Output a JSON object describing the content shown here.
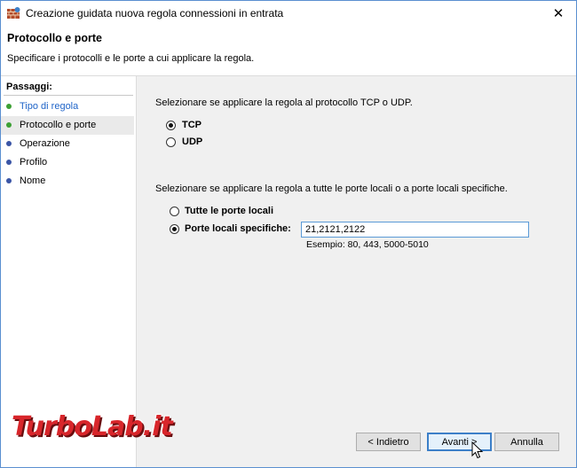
{
  "window": {
    "title": "Creazione guidata nuova regola connessioni in entrata",
    "close_label": "✕"
  },
  "header": {
    "title": "Protocollo e porte",
    "subtitle": "Specificare i protocolli e le porte a cui applicare la regola."
  },
  "sidebar": {
    "label": "Passaggi:",
    "steps": [
      {
        "label": "Tipo di regola",
        "state": "completed"
      },
      {
        "label": "Protocollo e porte",
        "state": "current"
      },
      {
        "label": "Operazione",
        "state": "pending"
      },
      {
        "label": "Profilo",
        "state": "pending"
      },
      {
        "label": "Nome",
        "state": "pending"
      }
    ]
  },
  "protocol": {
    "question": "Selezionare se applicare la regola al protocollo TCP o UDP.",
    "tcp_label": "TCP",
    "udp_label": "UDP",
    "selected": "TCP"
  },
  "ports": {
    "question": "Selezionare se applicare la regola a tutte le porte locali o a porte locali specifiche.",
    "all_label": "Tutte le porte locali",
    "specific_label": "Porte locali specifiche:",
    "selected": "specific",
    "value": "21,2121,2122",
    "example": "Esempio: 80, 443, 5000-5010"
  },
  "buttons": {
    "back": "< Indietro",
    "next": "Avanti >",
    "cancel": "Annulla"
  },
  "watermark": "TurboLab.it",
  "colors": {
    "accent": "#3c7fc8",
    "link": "#1f64c8",
    "completed_dot": "#3ca034",
    "pending_dot": "#3a55a6",
    "watermark": "#d8262b"
  }
}
